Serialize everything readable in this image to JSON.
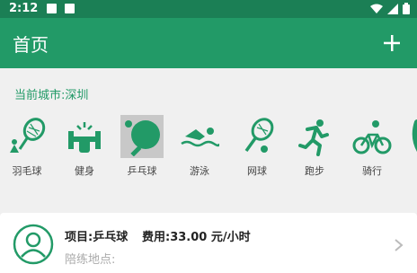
{
  "status_bar": {
    "time": "2:12"
  },
  "app_bar": {
    "title": "首页",
    "add_icon": "plus-icon"
  },
  "city": {
    "text": "当前城市:深圳"
  },
  "sports": [
    {
      "label": "羽毛球",
      "icon": "badminton-icon"
    },
    {
      "label": "健身",
      "icon": "fitness-icon"
    },
    {
      "label": "乒乓球",
      "icon": "ping-pong-icon",
      "selected": true
    },
    {
      "label": "游泳",
      "icon": "swimming-icon"
    },
    {
      "label": "网球",
      "icon": "tennis-icon"
    },
    {
      "label": "跑步",
      "icon": "running-icon"
    },
    {
      "label": "骑行",
      "icon": "cycling-icon"
    },
    {
      "label": "",
      "icon": "partial-icon"
    }
  ],
  "card": {
    "project": "项目:乒乓球",
    "fee": "费用:33.00 元/小时",
    "place": "陪练地点:"
  },
  "colors": {
    "primary": "#229a67",
    "status": "#1b7f55"
  }
}
